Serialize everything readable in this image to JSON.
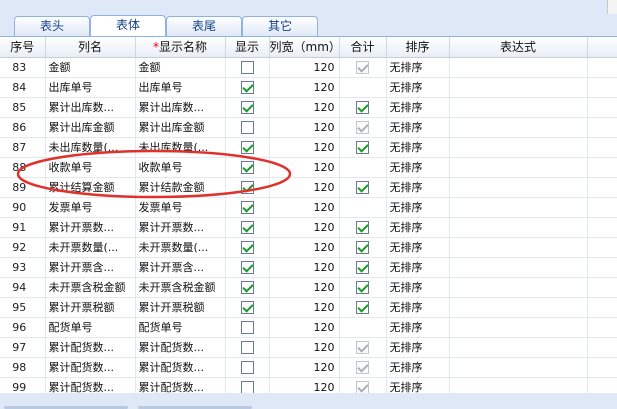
{
  "tabs": [
    {
      "label": "表头",
      "active": false
    },
    {
      "label": "表体",
      "active": true
    },
    {
      "label": "表尾",
      "active": false
    },
    {
      "label": "其它",
      "active": false
    }
  ],
  "columns": {
    "seq": "序号",
    "name": "列名",
    "required_mark": "*",
    "display_name": "显示名称",
    "show": "显示",
    "width": "列宽（mm）",
    "total": "合计",
    "sort": "排序",
    "expr": "表达式"
  },
  "rows": [
    {
      "seq": "83",
      "name": "金额",
      "display": "金额",
      "show": false,
      "width": "120",
      "total": true,
      "total_dim": true,
      "sort": "无排序"
    },
    {
      "seq": "84",
      "name": "出库单号",
      "display": "出库单号",
      "show": true,
      "width": "120",
      "total": null,
      "total_dim": false,
      "sort": "无排序"
    },
    {
      "seq": "85",
      "name": "累计出库数...",
      "display": "累计出库数...",
      "show": true,
      "width": "120",
      "total": true,
      "total_dim": false,
      "sort": "无排序"
    },
    {
      "seq": "86",
      "name": "累计出库金额",
      "display": "累计出库金额",
      "show": false,
      "width": "120",
      "total": true,
      "total_dim": true,
      "sort": "无排序"
    },
    {
      "seq": "87",
      "name": "未出库数量(...",
      "display": "未出库数量(...",
      "show": true,
      "width": "120",
      "total": true,
      "total_dim": false,
      "sort": "无排序"
    },
    {
      "seq": "88",
      "name": "收款单号",
      "display": "收款单号",
      "show": true,
      "width": "120",
      "total": null,
      "total_dim": false,
      "sort": "无排序"
    },
    {
      "seq": "89",
      "name": "累计结算金额",
      "display": "累计结款金额",
      "show": true,
      "width": "120",
      "total": true,
      "total_dim": false,
      "sort": "无排序"
    },
    {
      "seq": "90",
      "name": "发票单号",
      "display": "发票单号",
      "show": true,
      "width": "120",
      "total": null,
      "total_dim": false,
      "sort": "无排序"
    },
    {
      "seq": "91",
      "name": "累计开票数...",
      "display": "累计开票数...",
      "show": true,
      "width": "120",
      "total": true,
      "total_dim": false,
      "sort": "无排序"
    },
    {
      "seq": "92",
      "name": "未开票数量(...",
      "display": "未开票数量(...",
      "show": true,
      "width": "120",
      "total": true,
      "total_dim": false,
      "sort": "无排序"
    },
    {
      "seq": "93",
      "name": "累计开票含...",
      "display": "累计开票含...",
      "show": true,
      "width": "120",
      "total": true,
      "total_dim": false,
      "sort": "无排序"
    },
    {
      "seq": "94",
      "name": "未开票含税金额",
      "display": "未开票含税金额",
      "show": true,
      "width": "120",
      "total": true,
      "total_dim": false,
      "sort": "无排序"
    },
    {
      "seq": "95",
      "name": "累计开票税额",
      "display": "累计开票税额",
      "show": true,
      "width": "120",
      "total": true,
      "total_dim": false,
      "sort": "无排序"
    },
    {
      "seq": "96",
      "name": "配货单号",
      "display": "配货单号",
      "show": false,
      "width": "120",
      "total": null,
      "total_dim": false,
      "sort": "无排序"
    },
    {
      "seq": "97",
      "name": "累计配货数...",
      "display": "累计配货数...",
      "show": false,
      "width": "120",
      "total": true,
      "total_dim": true,
      "sort": "无排序"
    },
    {
      "seq": "98",
      "name": "累计配货数...",
      "display": "累计配货数...",
      "show": false,
      "width": "120",
      "total": true,
      "total_dim": true,
      "sort": "无排序"
    },
    {
      "seq": "99",
      "name": "累计配货数...",
      "display": "累计配货数...",
      "show": false,
      "width": "120",
      "total": true,
      "total_dim": true,
      "sort": "无排序"
    }
  ],
  "annotation": {
    "color": "#e0312b",
    "covers_rows": [
      "88",
      "89"
    ]
  }
}
